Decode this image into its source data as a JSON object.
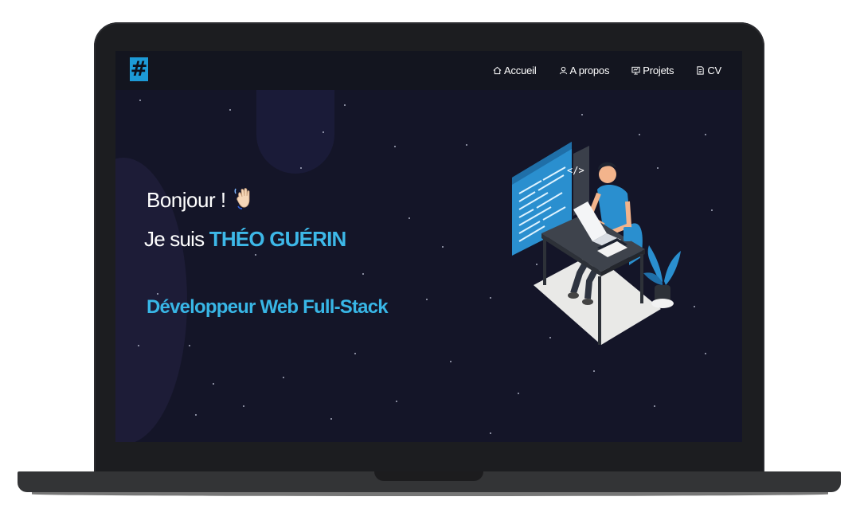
{
  "nav": {
    "logo_text": "#",
    "links": [
      {
        "label": "Accueil",
        "icon": "home-icon"
      },
      {
        "label": "A propos",
        "icon": "user-icon"
      },
      {
        "label": "Projets",
        "icon": "presentation-icon"
      },
      {
        "label": "CV",
        "icon": "document-icon"
      }
    ]
  },
  "hero": {
    "greeting": "Bonjour !",
    "intro_prefix": "Je suis ",
    "name": "THÉO GUÉRIN",
    "role": "Développeur Web Full-Stack"
  },
  "colors": {
    "accent": "#3db8e8",
    "background": "#141528",
    "navbar": "#13151f",
    "laptop_frame": "#1c1d20"
  }
}
